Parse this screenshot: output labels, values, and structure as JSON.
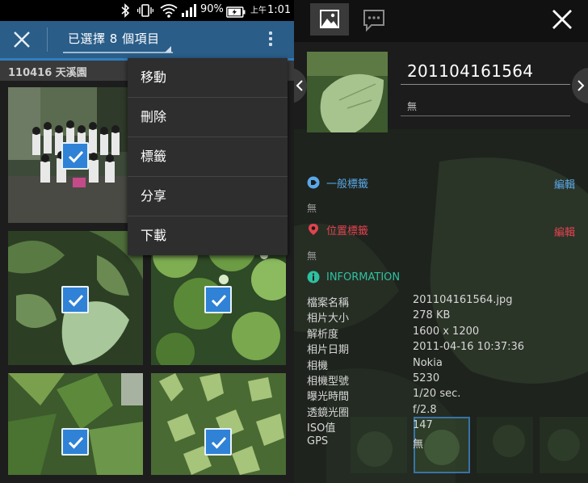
{
  "status": {
    "battery": "90%",
    "ampm": "上午",
    "time": "1:01"
  },
  "action_bar": {
    "selection_title": "已選擇 8 個項目"
  },
  "album": {
    "title": "110416 天溪園"
  },
  "menu": {
    "items": [
      "移動",
      "刪除",
      "標籤",
      "分享",
      "下載"
    ]
  },
  "detail": {
    "filename": "201104161564",
    "description": "無",
    "general_tags": {
      "title": "一般標籤",
      "edit": "編輯",
      "value": "無"
    },
    "location_tags": {
      "title": "位置標籤",
      "edit": "編輯",
      "value": "無"
    },
    "information": {
      "title": "INFORMATION",
      "rows": [
        {
          "key": "檔案名稱",
          "value": "201104161564.jpg"
        },
        {
          "key": "相片大小",
          "value": "278 KB"
        },
        {
          "key": "解析度",
          "value": "1600 x 1200"
        },
        {
          "key": "相片日期",
          "value": "2011-04-16 10:37:36"
        },
        {
          "key": "相機",
          "value": "Nokia"
        },
        {
          "key": "相機型號",
          "value": "5230"
        },
        {
          "key": "曝光時間",
          "value": "1/20 sec."
        },
        {
          "key": "透鏡光圈",
          "value": "f/2.8"
        },
        {
          "key": "ISO值",
          "value": "147"
        },
        {
          "key": "GPS",
          "value": "無"
        }
      ]
    }
  },
  "colors": {
    "accent_blue": "#2f82d6",
    "tag_blue": "#5aa8e8",
    "location_red": "#e2434f",
    "info_green": "#2fc0a0",
    "toolbar": "#2a5d88"
  },
  "icons": [
    "bluetooth-icon",
    "vibrate-icon",
    "wifi-icon",
    "signal-icon",
    "battery-charging-icon",
    "close-icon",
    "overflow-menu-icon",
    "check-icon",
    "photo-tab-icon",
    "comment-tab-icon",
    "tag-icon",
    "location-pin-icon",
    "info-icon",
    "chevron-left-icon",
    "chevron-right-icon"
  ]
}
